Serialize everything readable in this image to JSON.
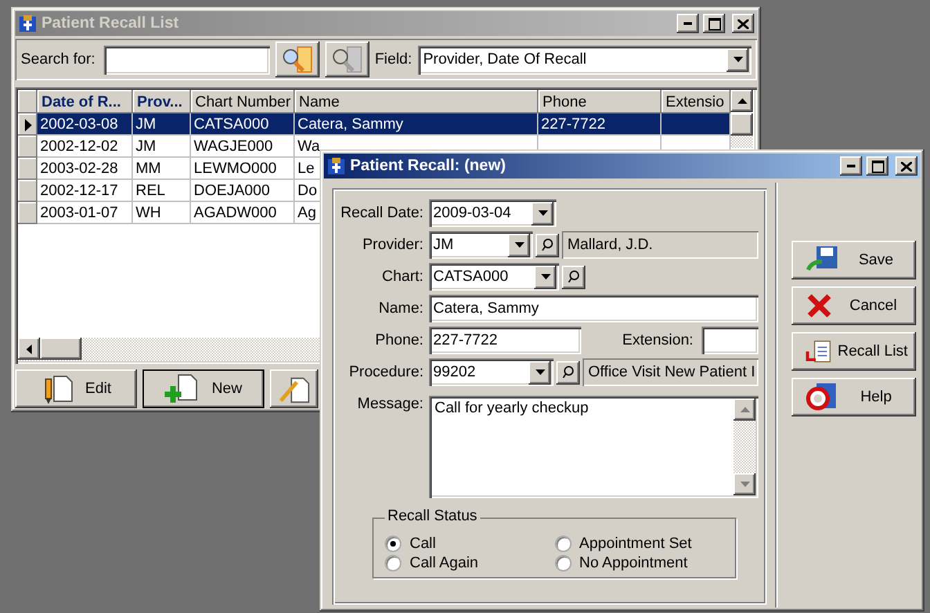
{
  "recall_list_window": {
    "title": "Patient Recall List",
    "active": false,
    "search": {
      "label": "Search for:"
    },
    "field": {
      "label": "Field:",
      "value": "Provider, Date Of Recall"
    },
    "table": {
      "columns": [
        {
          "label": "Date of R...",
          "sorted": true
        },
        {
          "label": "Prov...",
          "sorted": true
        },
        {
          "label": "Chart Number",
          "sorted": false
        },
        {
          "label": "Name",
          "sorted": false
        },
        {
          "label": "Phone",
          "sorted": false
        },
        {
          "label": "Extensio",
          "sorted": false
        }
      ],
      "rows": [
        {
          "selected": true,
          "cells": [
            "2002-03-08",
            "JM",
            "CATSA000",
            "Catera, Sammy",
            "227-7722",
            ""
          ]
        },
        {
          "selected": false,
          "cells": [
            "2002-12-02",
            "JM",
            "WAGJE000",
            "Wa",
            "",
            ""
          ]
        },
        {
          "selected": false,
          "cells": [
            "2003-02-28",
            "MM",
            "LEWMO000",
            "Le",
            "",
            ""
          ]
        },
        {
          "selected": false,
          "cells": [
            "2002-12-17",
            "REL",
            "DOEJA000",
            "Do",
            "",
            ""
          ]
        },
        {
          "selected": false,
          "cells": [
            "2003-01-07",
            "WH",
            "AGADW000",
            "Ag",
            "",
            ""
          ]
        }
      ]
    },
    "buttons": [
      {
        "label": "Edit",
        "default": false,
        "kind": "edit"
      },
      {
        "label": "New",
        "default": true,
        "kind": "new"
      }
    ]
  },
  "recall_window": {
    "title": "Patient Recall: (new)",
    "active": true,
    "recall_date": {
      "label": "Recall Date:",
      "value": "2009-03-04"
    },
    "provider": {
      "label": "Provider:",
      "value": "JM",
      "description": "Mallard, J.D."
    },
    "chart": {
      "label": "Chart:",
      "value": "CATSA000"
    },
    "name": {
      "label": "Name:",
      "value": "Catera, Sammy"
    },
    "phone": {
      "label": "Phone:",
      "value": "227-7722"
    },
    "extension": {
      "label": "Extension:"
    },
    "procedure": {
      "label": "Procedure:",
      "value": "99202",
      "description": "Office Visit New Patient I"
    },
    "message": {
      "label": "Message:",
      "value": "Call for yearly checkup"
    },
    "recall_status": {
      "title": "Recall Status",
      "options": [
        {
          "label": "Call",
          "selected": true
        },
        {
          "label": "Appointment Set",
          "selected": false
        },
        {
          "label": "Call Again",
          "selected": false
        },
        {
          "label": "No Appointment",
          "selected": false
        }
      ]
    },
    "buttons": [
      {
        "label": "Save",
        "kind": "save"
      },
      {
        "label": "Cancel",
        "kind": "cancel"
      },
      {
        "label": "Recall List",
        "kind": "list"
      },
      {
        "label": "Help",
        "kind": "help"
      }
    ]
  }
}
